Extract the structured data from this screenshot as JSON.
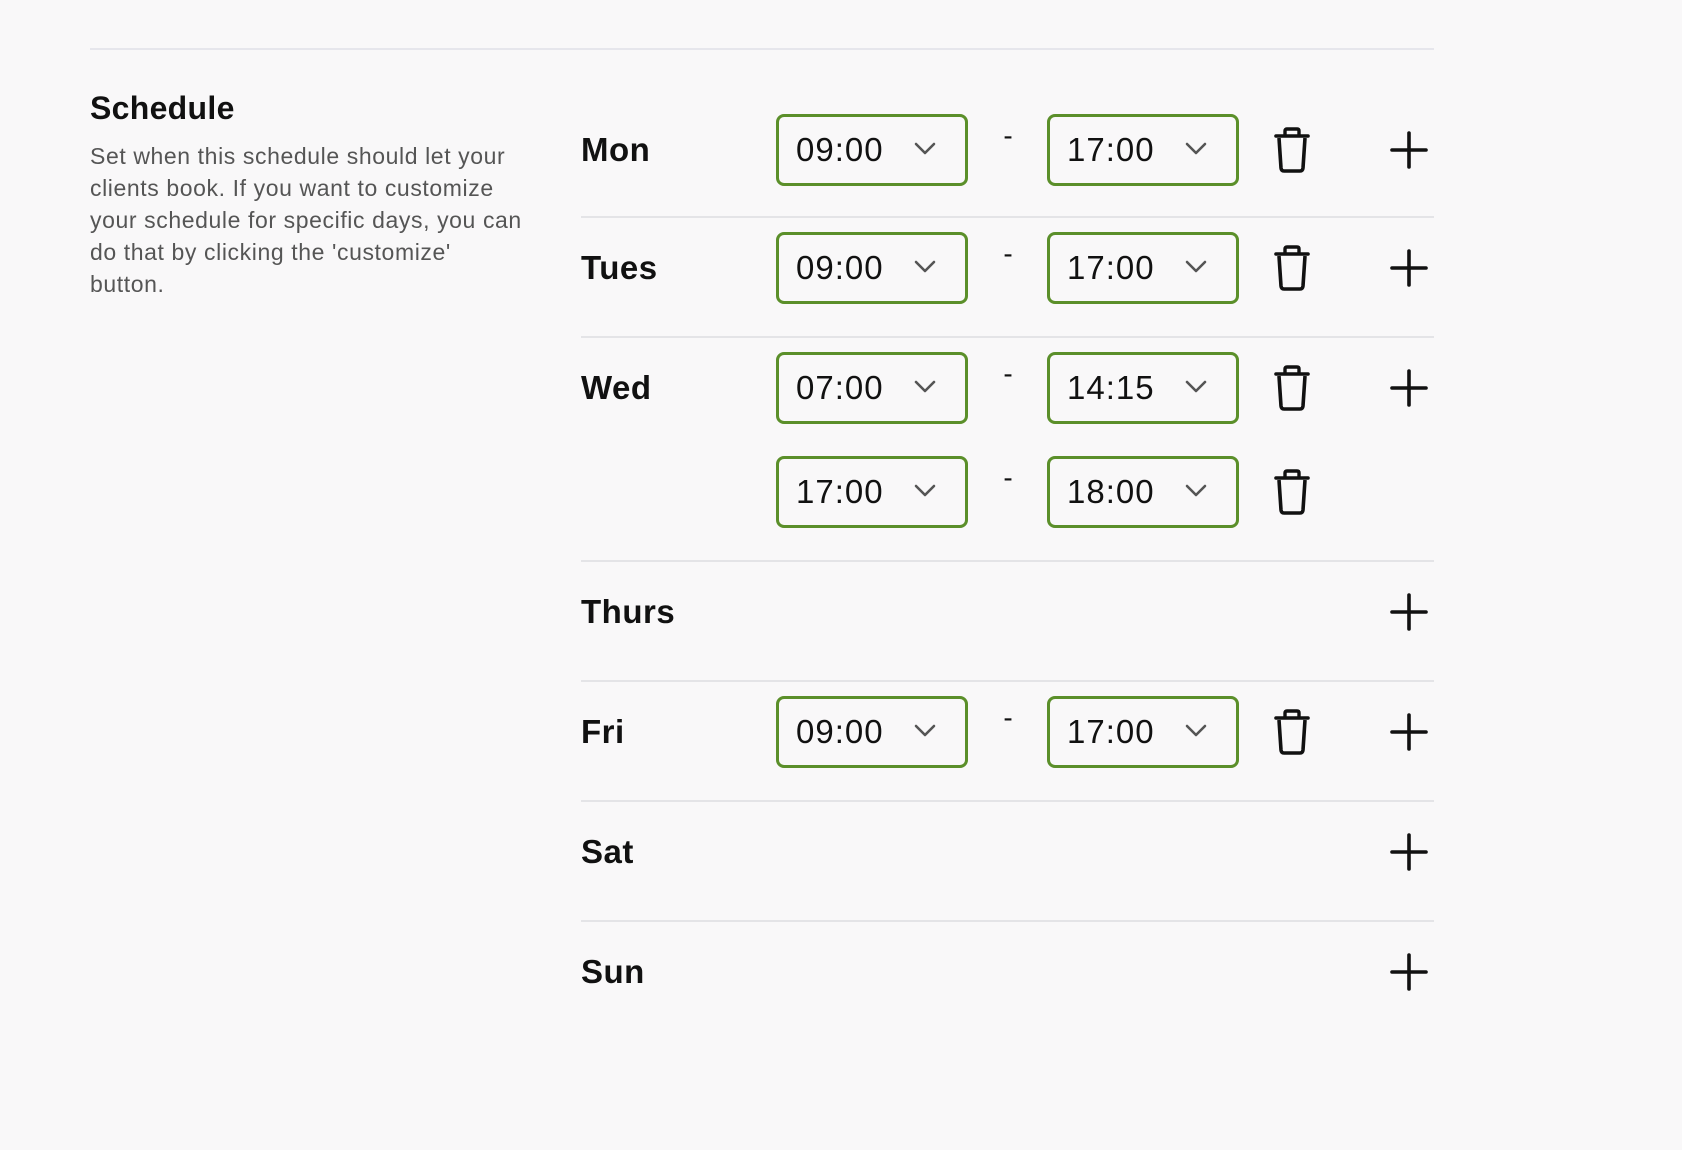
{
  "section": {
    "title": "Schedule",
    "description": "Set when this schedule should let your clients book. If you want to customize your schedule for specific days, you can do that by clicking the 'customize' button."
  },
  "separator": "-",
  "icons": {
    "dropdown": "chevron-down-icon",
    "delete": "trash-icon",
    "add": "plus-icon"
  },
  "colors": {
    "select_border": "#5b8f2a",
    "divider": "#e4e4e7",
    "background": "#f9f8f9"
  },
  "days": [
    {
      "label": "Mon",
      "slots": [
        {
          "start": "09:00",
          "end": "17:00"
        }
      ]
    },
    {
      "label": "Tues",
      "slots": [
        {
          "start": "09:00",
          "end": "17:00"
        }
      ]
    },
    {
      "label": "Wed",
      "slots": [
        {
          "start": "07:00",
          "end": "14:15"
        },
        {
          "start": "17:00",
          "end": "18:00"
        }
      ]
    },
    {
      "label": "Thurs",
      "slots": []
    },
    {
      "label": "Fri",
      "slots": [
        {
          "start": "09:00",
          "end": "17:00"
        }
      ]
    },
    {
      "label": "Sat",
      "slots": []
    },
    {
      "label": "Sun",
      "slots": []
    }
  ]
}
